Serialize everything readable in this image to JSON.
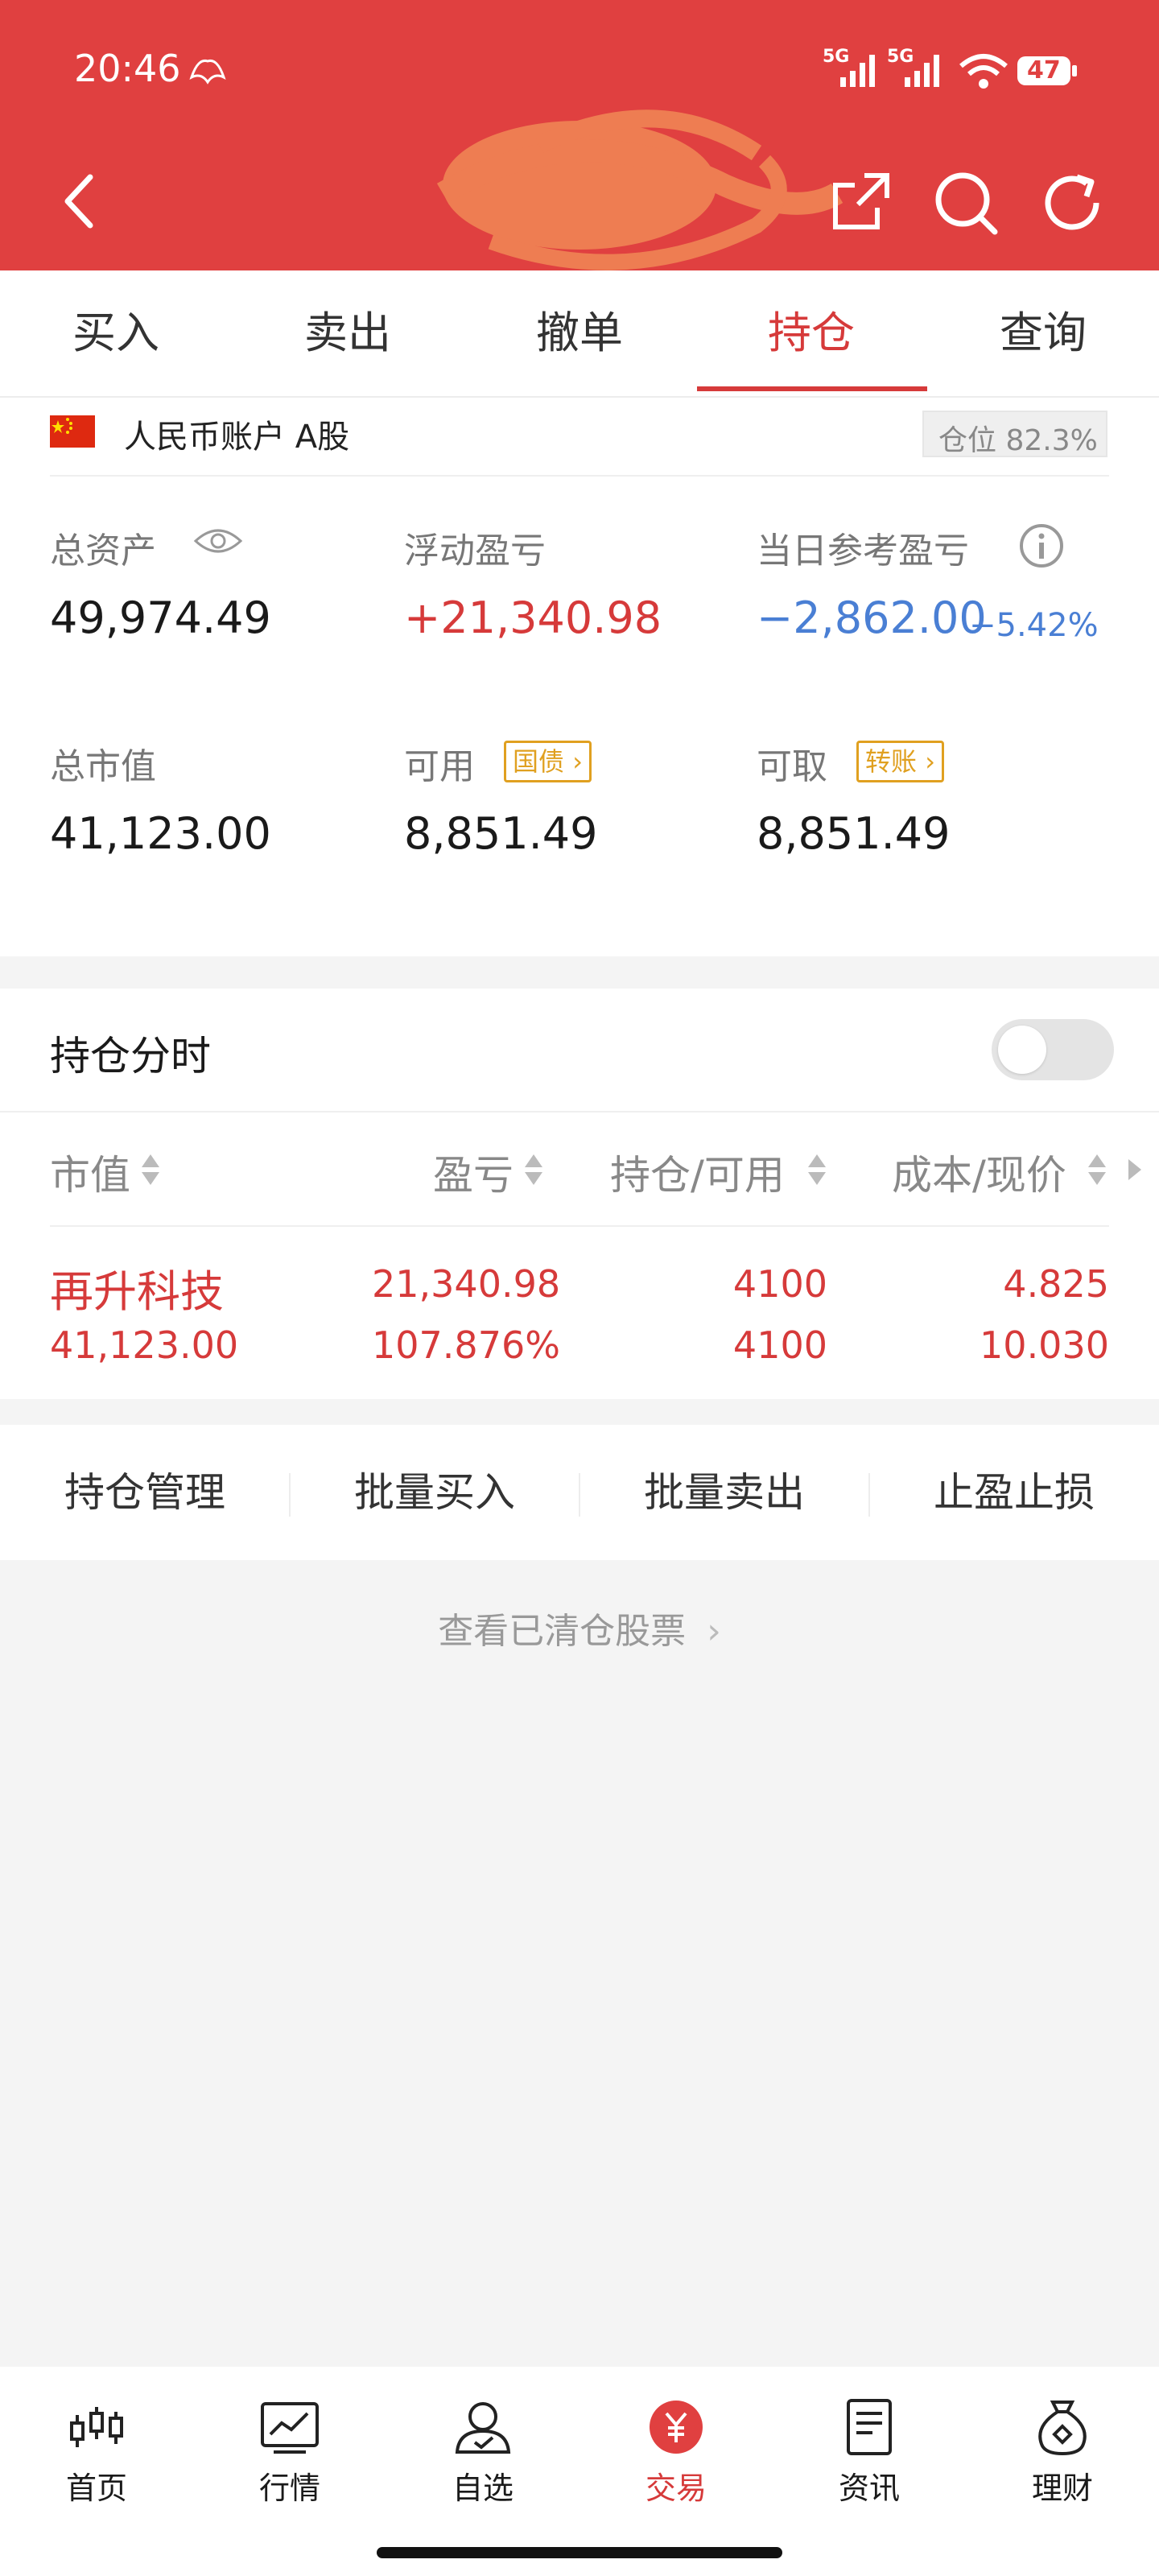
{
  "status_bar": {
    "time": "20:46",
    "network_1": "5G",
    "network_2": "5G",
    "battery": "47"
  },
  "tabs": [
    {
      "label": "买入"
    },
    {
      "label": "卖出"
    },
    {
      "label": "撤单"
    },
    {
      "label": "持仓",
      "active": true
    },
    {
      "label": "查询"
    }
  ],
  "account": {
    "label": "人民币账户 A股",
    "position_text": "仓位 82.3%",
    "total_assets_label": "总资产",
    "total_assets": "49,974.49",
    "floating_pnl_label": "浮动盈亏",
    "floating_pnl": "+21,340.98",
    "daily_pnl_label": "当日参考盈亏",
    "daily_pnl": "−2,862.00",
    "daily_pnl_pct": "−5.42%",
    "market_value_label": "总市值",
    "market_value": "41,123.00",
    "available_label": "可用",
    "available": "8,851.49",
    "bond_tag": "国债",
    "withdrawable_label": "可取",
    "withdrawable": "8,851.49",
    "transfer_tag": "转账"
  },
  "timeshare": {
    "label": "持仓分时",
    "enabled": false
  },
  "holdings": {
    "headers": {
      "market_value": "市值",
      "pnl": "盈亏",
      "position": "持仓/可用",
      "cost": "成本/现价"
    },
    "rows": [
      {
        "name": "再升科技",
        "market_value": "41,123.00",
        "pnl": "21,340.98",
        "pnl_pct": "107.876%",
        "position": "4100",
        "available": "4100",
        "cost": "4.825",
        "price": "10.030"
      }
    ]
  },
  "actions": [
    {
      "label": "持仓管理"
    },
    {
      "label": "批量买入"
    },
    {
      "label": "批量卖出"
    },
    {
      "label": "止盈止损"
    }
  ],
  "cleared_link": "查看已清仓股票",
  "bottom_nav": [
    {
      "label": "首页",
      "icon": "candlestick-icon"
    },
    {
      "label": "行情",
      "icon": "chart-icon"
    },
    {
      "label": "自选",
      "icon": "user-check-icon"
    },
    {
      "label": "交易",
      "icon": "yuan-icon",
      "active": true
    },
    {
      "label": "资讯",
      "icon": "document-icon"
    },
    {
      "label": "理财",
      "icon": "money-bag-icon"
    }
  ],
  "colors": {
    "brand_red": "#e04040",
    "gain_red": "#d63a3a",
    "loss_blue": "#4a7fd4",
    "tag_orange": "#e0a020"
  }
}
